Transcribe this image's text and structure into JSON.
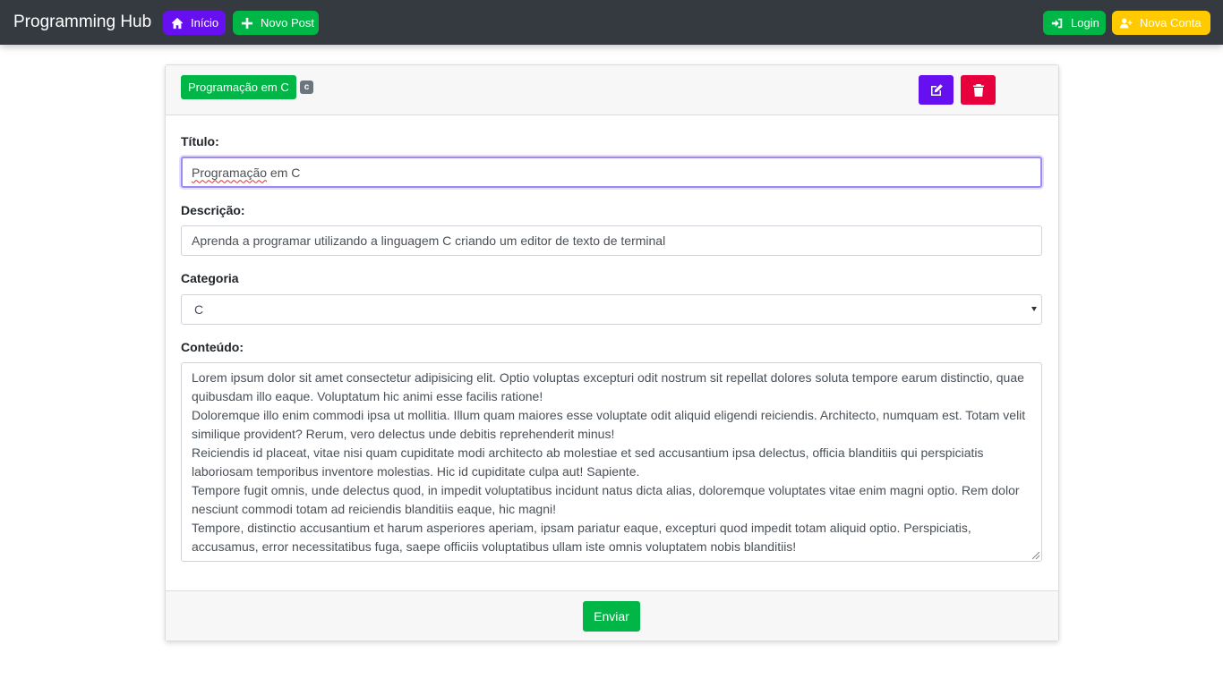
{
  "navbar": {
    "brand": "Programming Hub",
    "home_label": "Início",
    "new_post_label": "Novo Post",
    "login_label": "Login",
    "register_label": "Nova Conta"
  },
  "post": {
    "tag": "Programação em C",
    "category_badge": "c",
    "actions": {
      "edit_icon": "edit-icon",
      "delete_icon": "trash-icon"
    }
  },
  "form": {
    "title_label": "Título:",
    "title_value_word": "Programação",
    "title_value_rest": " em C",
    "description_label": "Descrição:",
    "description_value": "Aprenda a programar utilizando a linguagem C criando um editor de texto de terminal",
    "category_label": "Categoria",
    "category_value": "C",
    "content_label": "Conteúdo:",
    "content_paragraphs": [
      "Lorem ipsum dolor sit amet consectetur adipisicing elit. Optio voluptas excepturi odit nostrum sit repellat dolores soluta tempore earum distinctio, quae quibusdam illo eaque. Voluptatum hic animi esse facilis ratione!",
      "Doloremque illo enim commodi ipsa ut mollitia. Illum quam maiores esse voluptate odit aliquid eligendi reiciendis. Architecto, numquam est. Totam velit similique provident? Rerum, vero delectus unde debitis reprehenderit minus!",
      "Reiciendis id placeat, vitae nisi quam cupiditate modi architecto ab molestiae et sed accusantium ipsa delectus, officia blanditiis qui perspiciatis laboriosam temporibus inventore molestias. Hic id cupiditate culpa aut! Sapiente.",
      "Tempore fugit omnis, unde delectus quod, in impedit voluptatibus incidunt natus dicta alias, doloremque voluptates vitae enim magni optio. Rem dolor nesciunt commodi totam ad reiciendis blanditiis eaque, hic magni!",
      "Tempore, distinctio accusantium et harum asperiores aperiam, ipsam pariatur eaque, excepturi quod impedit totam aliquid optio. Perspiciatis, accusamus, error necessitatibus fuga, saepe officiis voluptatibus ullam iste omnis voluptatem nobis blanditiis!"
    ],
    "submit_label": "Enviar"
  },
  "colors": {
    "navbar_bg": "#343a40",
    "primary_purple": "#6610f2",
    "success_green": "#00b646",
    "warning_yellow": "#ffcb00",
    "danger_red": "#e8003c"
  }
}
